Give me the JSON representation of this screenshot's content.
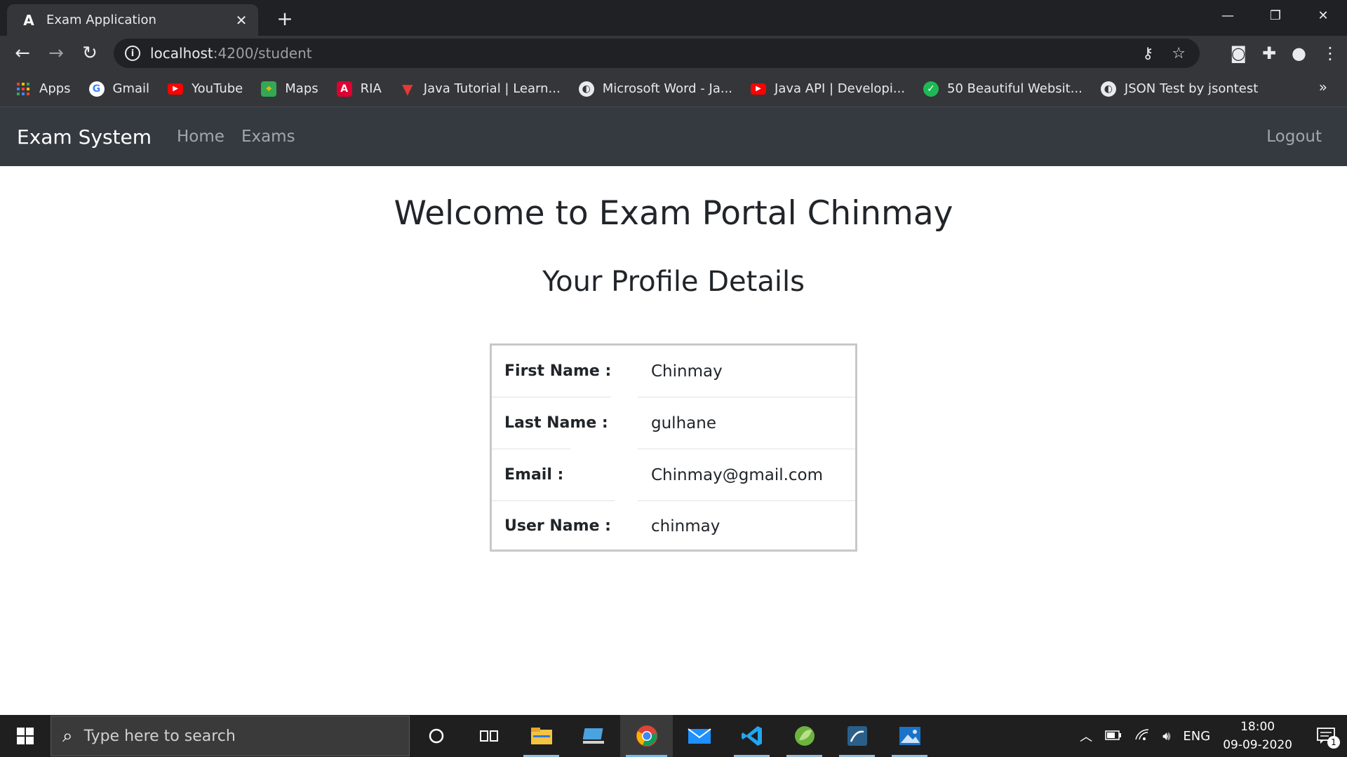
{
  "browser": {
    "tab_title": "Exam Application",
    "url_host": "localhost",
    "url_rest": ":4200/student",
    "bookmarks": [
      {
        "label": "Apps",
        "icon": "apps-grid-icon",
        "color": "#ea4335"
      },
      {
        "label": "Gmail",
        "icon": "google-icon",
        "color": "#ffffff"
      },
      {
        "label": "YouTube",
        "icon": "youtube-icon",
        "color": "#ff0000"
      },
      {
        "label": "Maps",
        "icon": "maps-icon",
        "color": "#34a853"
      },
      {
        "label": "RIA",
        "icon": "angular-icon",
        "color": "#dd0031"
      },
      {
        "label": "Java Tutorial | Learn...",
        "icon": "java-tutorial-icon",
        "color": "#e53935"
      },
      {
        "label": "Microsoft Word - Ja...",
        "icon": "globe-icon",
        "color": "#e8eaed"
      },
      {
        "label": "Java API | Developi...",
        "icon": "youtube-icon",
        "color": "#ff0000"
      },
      {
        "label": "50 Beautiful Websit...",
        "icon": "check-circle-icon",
        "color": "#1db954"
      },
      {
        "label": "JSON Test by jsontest",
        "icon": "globe-icon",
        "color": "#e8eaed"
      }
    ]
  },
  "app": {
    "brand": "Exam System",
    "nav": {
      "home": "Home",
      "exams": "Exams",
      "logout": "Logout"
    }
  },
  "main": {
    "welcome": "Welcome to Exam Portal Chinmay",
    "subtitle": "Your Profile Details",
    "profile": [
      {
        "label": "First Name :",
        "value": "Chinmay"
      },
      {
        "label": "Last Name :",
        "value": "gulhane"
      },
      {
        "label": "Email :",
        "value": "Chinmay@gmail.com"
      },
      {
        "label": "User Name :",
        "value": "chinmay"
      }
    ]
  },
  "taskbar": {
    "search_placeholder": "Type here to search",
    "language": "ENG",
    "time": "18:00",
    "date": "09-09-2020",
    "notification_count": "1"
  }
}
